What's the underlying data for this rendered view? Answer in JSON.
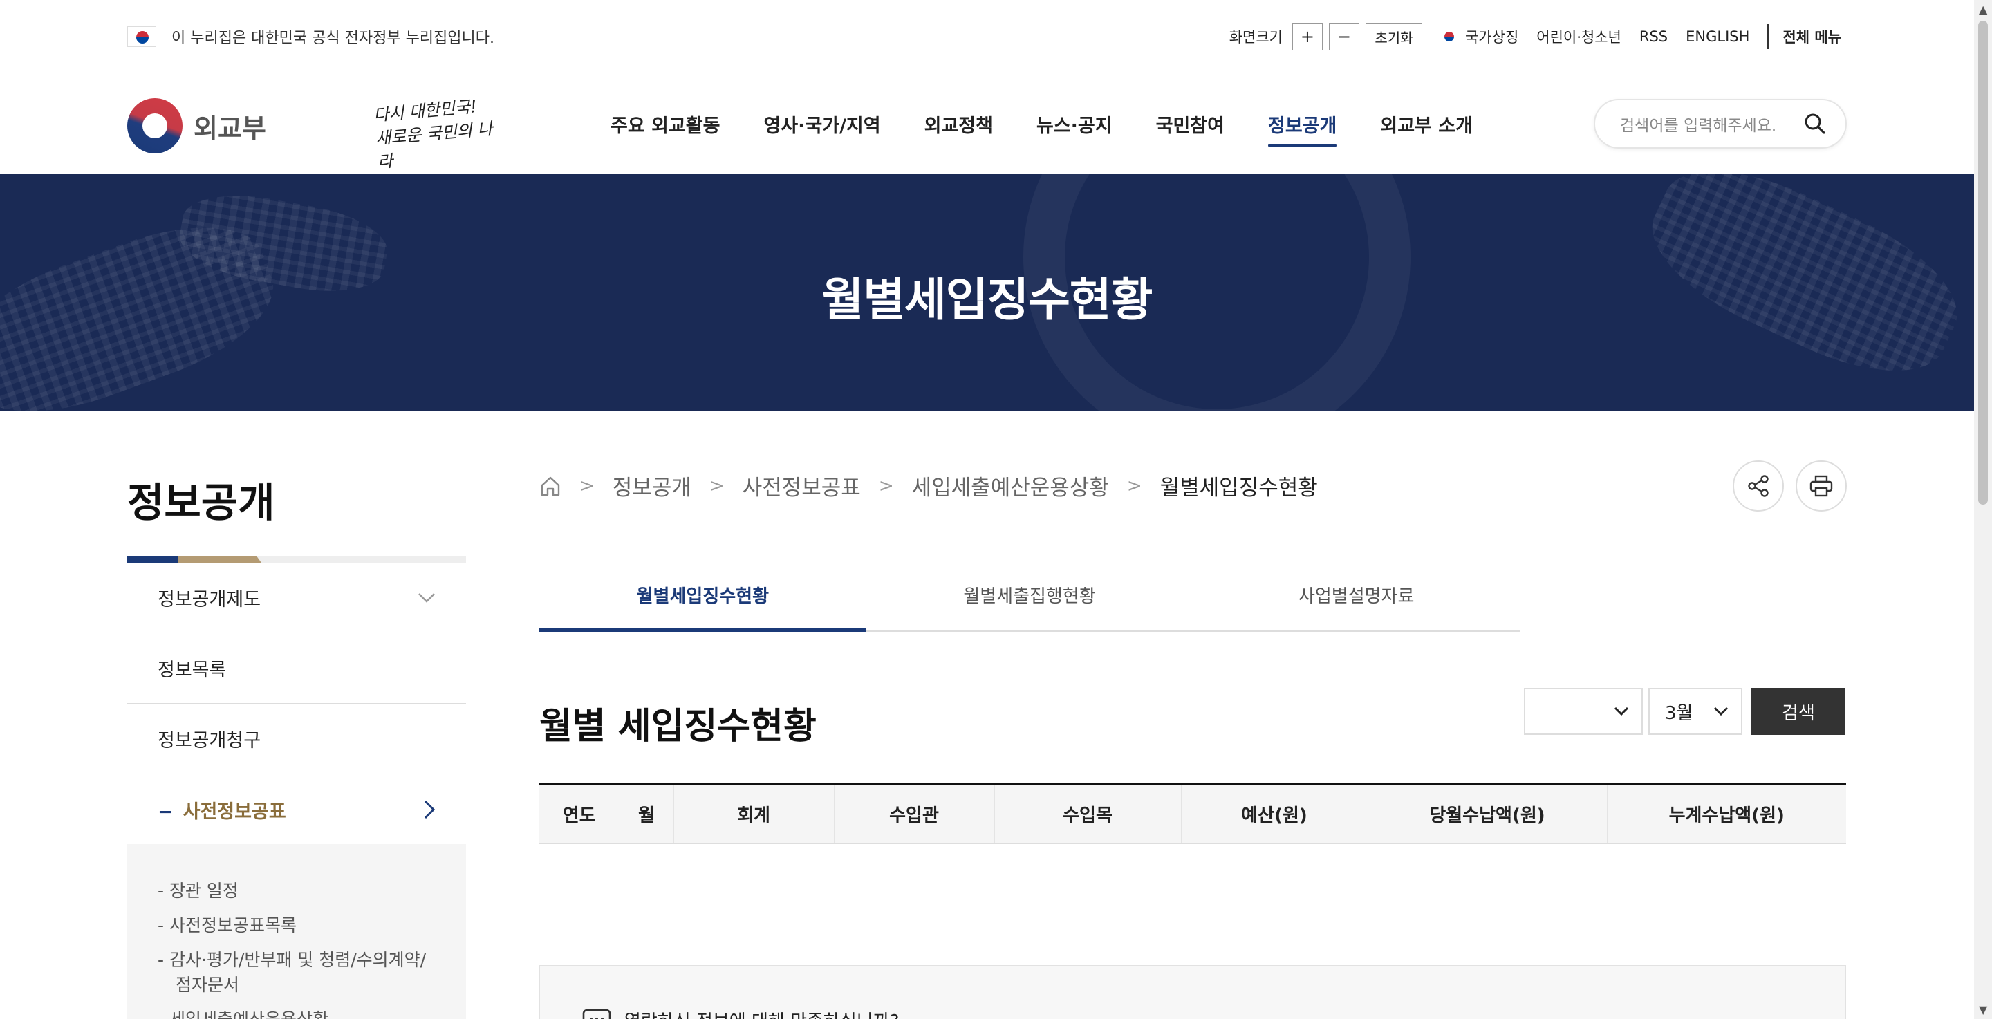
{
  "gov_banner": {
    "text": "이 누리집은 대한민국 공식 전자정부 누리집입니다."
  },
  "utility": {
    "font_size_label": "화면크기",
    "plus": "+",
    "minus": "−",
    "reset": "초기화",
    "national_symbol": "국가상징",
    "kids": "어린이·청소년",
    "rss": "RSS",
    "english": "ENGLISH",
    "all_menu": "전체 메뉴"
  },
  "logo": {
    "text": "외교부"
  },
  "slogan": {
    "line1": "다시 대한민국!",
    "line2": "새로운 국민의 나라"
  },
  "gnb": {
    "items": [
      "주요 외교활동",
      "영사·국가/지역",
      "외교정책",
      "뉴스·공지",
      "국민참여",
      "정보공개",
      "외교부 소개"
    ],
    "active_index": 5
  },
  "search": {
    "placeholder": "검색어를 입력해주세요."
  },
  "banner": {
    "title": "월별세입징수현황"
  },
  "sidebar": {
    "title": "정보공개",
    "items": [
      {
        "label": "정보공개제도",
        "chevron": "chevron-down-icon"
      },
      {
        "label": "정보목록"
      },
      {
        "label": "정보공개청구"
      },
      {
        "label": "사전정보공표",
        "chevron": "chevron-right-icon",
        "current": true
      }
    ],
    "sub_items": [
      "장관 일정",
      "사전정보공표목록",
      "감사·평가/반부패 및 청렴/수의계약/점자문서",
      "세입세출예산운용상황"
    ]
  },
  "breadcrumb": [
    "정보공개",
    "사전정보공표",
    "세입세출예산운용상황",
    "월별세입징수현황"
  ],
  "tabs": [
    "월별세입징수현황",
    "월별세출집행현황",
    "사업별설명자료"
  ],
  "content": {
    "title": "월별 세입징수현황",
    "year_select": "",
    "month_select": "3월",
    "search_button": "검색"
  },
  "table": {
    "headers": [
      "연도",
      "월",
      "회계",
      "수입관",
      "수입목",
      "예산(원)",
      "당월수납액(원)",
      "누계수납액(원)"
    ]
  },
  "survey": {
    "question": "열람하신 정보에 대해 만족하십니까?"
  },
  "colors": {
    "navy": "#1b3a78",
    "banner": "#1a2a55",
    "gold": "#8a6d3b",
    "button_dark": "#333333"
  }
}
